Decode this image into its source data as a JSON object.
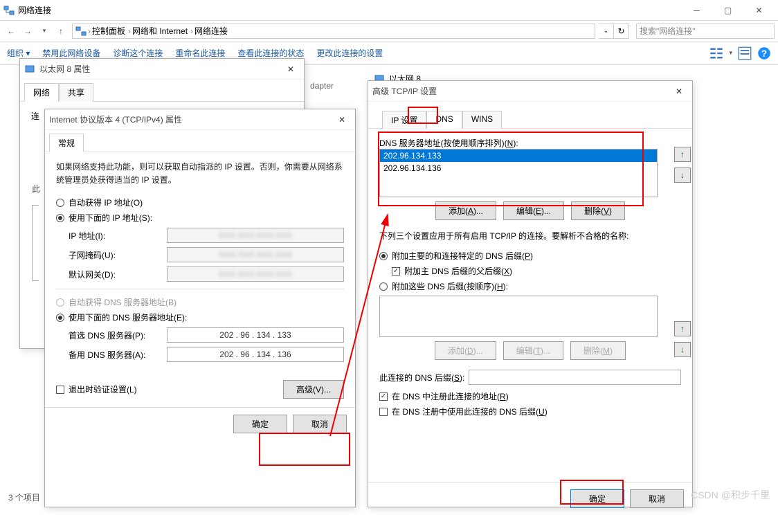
{
  "explorer": {
    "title": "网络连接",
    "breadcrumb": [
      "控制面板",
      "网络和 Internet",
      "网络连接"
    ],
    "search_placeholder": "搜索\"网络连接\"",
    "toolbar": {
      "org": "组织 ▾",
      "disable": "禁用此网络设备",
      "diagnose": "诊断这个连接",
      "rename": "重命名此连接",
      "status": "查看此连接的状态",
      "change": "更改此连接的设置"
    },
    "partial_item": "dapter",
    "item_count": "3 个项目",
    "ethernet_label": "以太网 8"
  },
  "ethernet_props": {
    "title": "以太网 8 属性",
    "tabs": {
      "network": "网络",
      "share": "共享"
    },
    "connect_prefix": "连"
  },
  "ipv4": {
    "title": "Internet 协议版本 4 (TCP/IPv4) 属性",
    "tab": "常规",
    "info": "如果网络支持此功能，则可以获取自动指派的 IP 设置。否则，你需要从网络系统管理员处获得适当的 IP 设置。",
    "auto_ip": "自动获得 IP 地址(O)",
    "use_ip": "使用下面的 IP 地址(S):",
    "ip_label": "IP 地址(I):",
    "mask_label": "子网掩码(U):",
    "gw_label": "默认网关(D):",
    "auto_dns": "自动获得 DNS 服务器地址(B)",
    "use_dns": "使用下面的 DNS 服务器地址(E):",
    "pref_dns_label": "首选 DNS 服务器(P):",
    "alt_dns_label": "备用 DNS 服务器(A):",
    "pref_dns": "202 . 96 . 134 . 133",
    "alt_dns": "202 . 96 . 134 . 136",
    "validate": "退出时验证设置(L)",
    "advanced": "高级(V)...",
    "ok": "确定",
    "cancel": "取消"
  },
  "adv": {
    "title": "高级 TCP/IP 设置",
    "tabs": {
      "ip": "IP 设置",
      "dns": "DNS",
      "wins": "WINS"
    },
    "dns_list_label": "DNS 服务器地址(按使用顺序排列)(N):",
    "dns_servers": [
      "202.96.134.133",
      "202.96.134.136"
    ],
    "btn_add": "添加(A)...",
    "btn_edit": "编辑(E)...",
    "btn_del": "删除(V)",
    "resolve_text": "下列三个设置应用于所有启用 TCP/IP 的连接。要解析不合格的名称:",
    "append_primary": "附加主要的和连接特定的 DNS 后缀(P)",
    "append_parent": "附加主 DNS 后缀的父后缀(X)",
    "append_these": "附加这些 DNS 后缀(按顺序)(H):",
    "btn_add_d": "添加(D)...",
    "btn_edit_t": "编辑(T)...",
    "btn_del_m": "删除(M)",
    "suffix_label": "此连接的 DNS 后缀(S):",
    "register": "在 DNS 中注册此连接的地址(R)",
    "use_suffix_reg": "在 DNS 注册中使用此连接的 DNS 后缀(U)",
    "ok": "确定",
    "cancel": "取消"
  },
  "watermark": "CSDN @积步千里",
  "side_label": "此"
}
